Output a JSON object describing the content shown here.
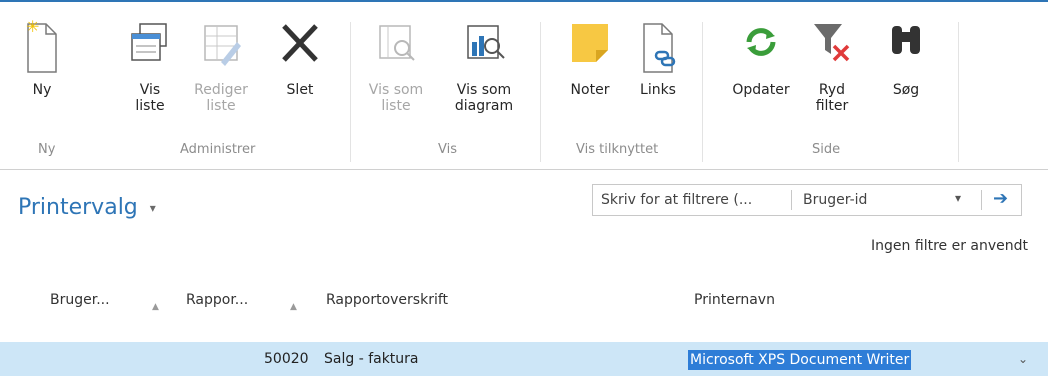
{
  "ribbon": {
    "buttons": [
      {
        "label": "Ny",
        "icon": "new-document-icon",
        "enabled": true
      },
      {
        "label": "Vis\nliste",
        "icon": "view-list-icon",
        "enabled": true
      },
      {
        "label": "Rediger\nliste",
        "icon": "edit-list-icon",
        "enabled": false
      },
      {
        "label": "Slet",
        "icon": "delete-x-icon",
        "enabled": true
      },
      {
        "label": "Vis som\nliste",
        "icon": "view-as-list-icon",
        "enabled": false
      },
      {
        "label": "Vis som\ndiagram",
        "icon": "view-as-chart-icon",
        "enabled": true
      },
      {
        "label": "Noter",
        "icon": "note-icon",
        "enabled": true
      },
      {
        "label": "Links",
        "icon": "link-document-icon",
        "enabled": true
      },
      {
        "label": "Opdater",
        "icon": "refresh-icon",
        "enabled": true
      },
      {
        "label": "Ryd\nfilter",
        "icon": "clear-filter-icon",
        "enabled": true
      },
      {
        "label": "Søg",
        "icon": "binoculars-icon",
        "enabled": true
      }
    ],
    "groups": [
      "Ny",
      "Administrer",
      "Vis",
      "Vis tilknyttet",
      "Side"
    ]
  },
  "page": {
    "title": "Printervalg",
    "title_caret": "▾"
  },
  "filter": {
    "placeholder": "Skriv for at filtrere (...",
    "field": "Bruger-id",
    "dropdown": "▾",
    "go": "➔",
    "status": "Ingen filtre er anvendt"
  },
  "table": {
    "columns": [
      "Bruger...",
      "Rappor...",
      "Rapportoverskrift",
      "Printernavn"
    ],
    "rows": [
      {
        "report_id": "50020",
        "caption": "Salg - faktura",
        "printer": "Microsoft XPS Document Writer"
      }
    ]
  },
  "colors": {
    "accent": "#2e75b6",
    "row_highlight": "#cde6f7",
    "selection": "#2e7dd7"
  }
}
